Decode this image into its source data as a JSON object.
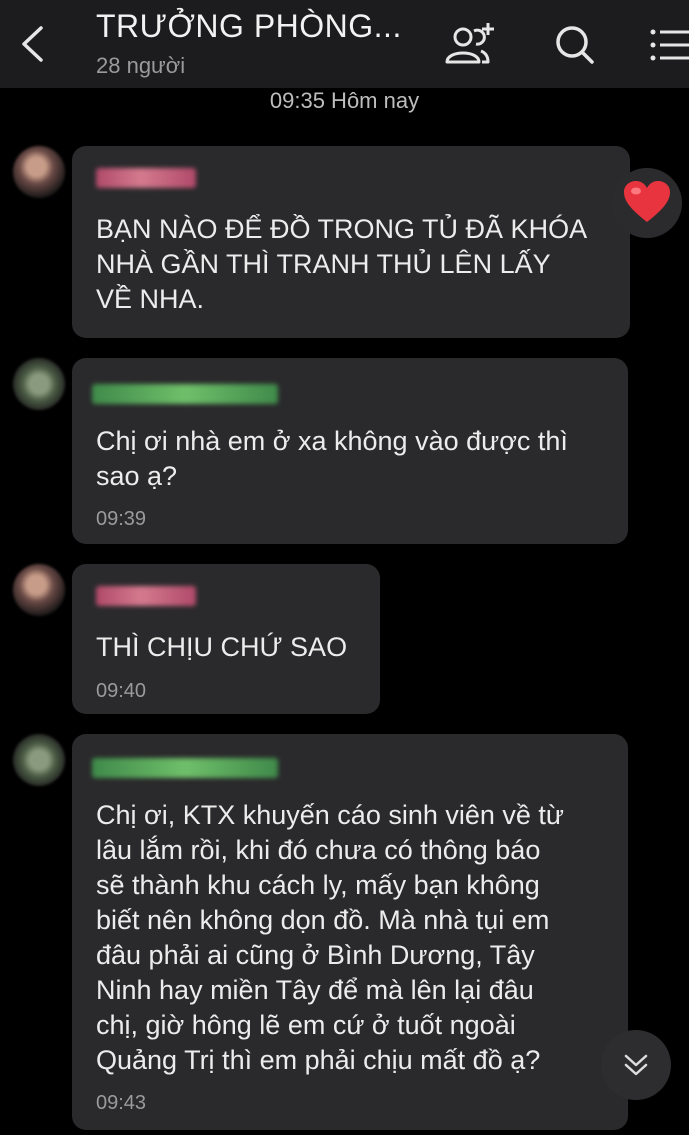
{
  "header": {
    "title": "TRƯỞNG PHÒNG...",
    "member_count": "28 người",
    "icons": [
      "back-chevron-icon",
      "add-member-icon",
      "search-icon",
      "menu-icon"
    ]
  },
  "date_divider": "09:35 Hôm nay",
  "messages": [
    {
      "sender_color": "#c8627c",
      "text": "BẠN NÀO ĐỂ ĐỒ TRONG TỦ ĐÃ KHÓA NHÀ GẦN THÌ TRANH THỦ LÊN LẤY VỀ NHA.",
      "lines": [
        "BẠN NÀO ĐỂ ĐỒ TRONG TỦ ĐÃ KHÓA",
        "NHÀ GẦN THÌ TRANH THỦ LÊN LẤY",
        "VỀ NHA."
      ],
      "time": "",
      "reaction": "heart-icon"
    },
    {
      "sender_color": "#5da85c",
      "lines": [
        "Chị ơi nhà em ở xa không vào được thì",
        "sao ạ?"
      ],
      "time": "09:39"
    },
    {
      "sender_color": "#c8627c",
      "lines": [
        "THÌ CHỊU CHỨ SAO"
      ],
      "time": "09:40"
    },
    {
      "sender_color": "#5da85c",
      "lines": [
        "Chị ơi, KTX khuyến cáo sinh viên về từ",
        "lâu lắm rồi, khi đó chưa có thông báo",
        "sẽ thành khu cách ly, mấy bạn không",
        "biết nên không dọn đồ. Mà nhà tụi em",
        "đâu phải ai cũng ở Bình Dương, Tây",
        "Ninh hay miền Tây để mà lên lại đâu",
        "chị, giờ hông lẽ em cứ ở tuốt ngoài",
        "Quảng Trị thì em phải chịu mất đồ ạ?"
      ],
      "time": "09:43"
    }
  ],
  "colors": {
    "background": "#000000",
    "header": "#1c1c1e",
    "bubble": "#2a2a2c",
    "heart": "#e8343e"
  }
}
